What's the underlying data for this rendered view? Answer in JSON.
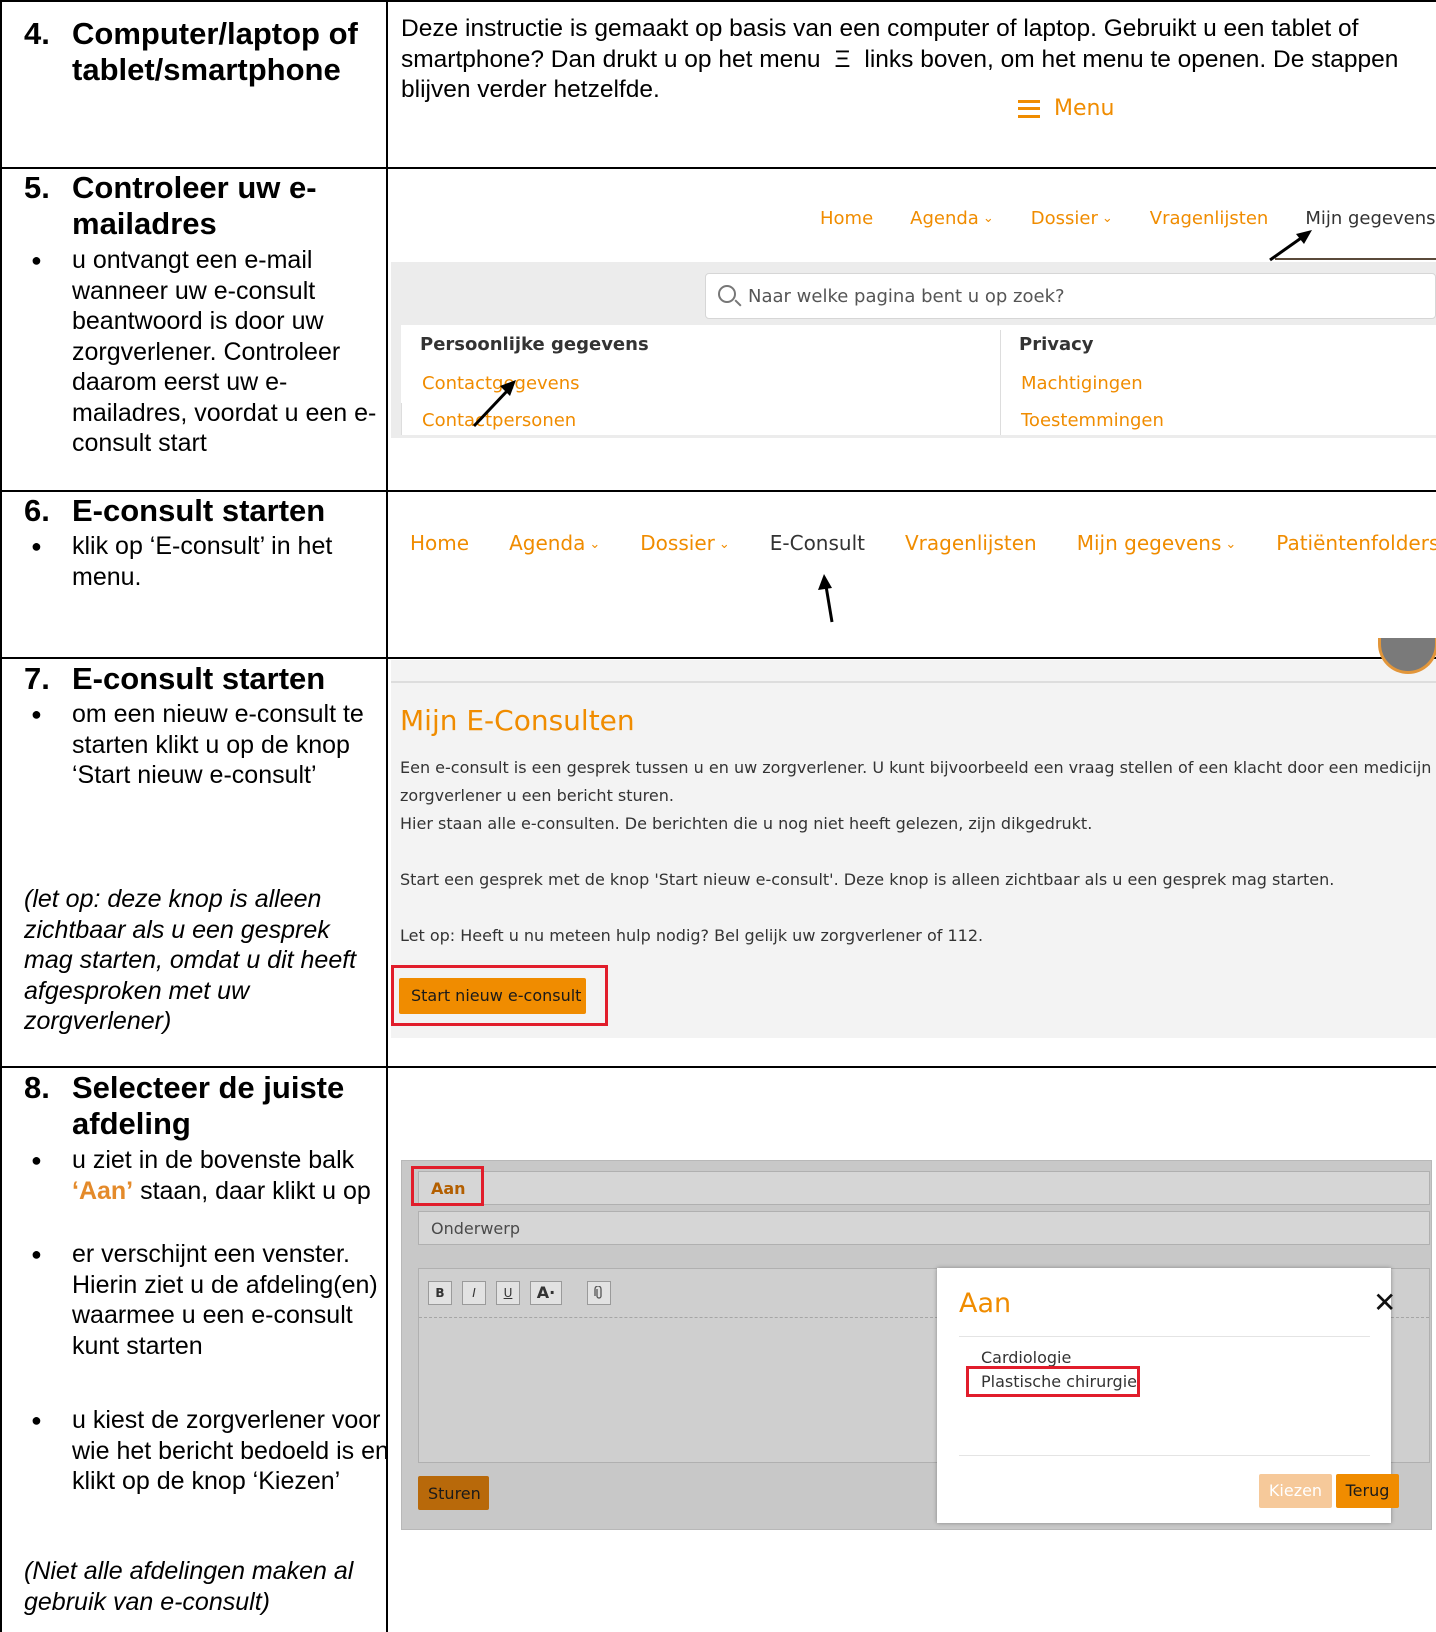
{
  "steps": [
    {
      "num": "4.",
      "title": "Computer/laptop of tablet/smartphone"
    },
    {
      "num": "5.",
      "title": "Controleer uw e-mailadres",
      "bullets": [
        "u ontvangt een e-mail wanneer uw e-consult beantwoord is door uw zorgverlener. Controleer daarom eerst uw e-mailadres, voordat u een e-consult start"
      ]
    },
    {
      "num": "6.",
      "title": "E-consult starten",
      "bullets": [
        "klik op ‘E-consult’ in het menu."
      ]
    },
    {
      "num": "7.",
      "title": "E-consult starten",
      "bullets": [
        "om een nieuw e-consult te starten klikt u op de knop ‘Start nieuw e-consult’"
      ],
      "note": "(let op: deze knop is alleen zichtbaar als u een gesprek mag starten, omdat u dit heeft afgesproken met uw zorgverlener)"
    },
    {
      "num": "8.",
      "title": "Selecteer de juiste afdeling",
      "bullet1_pre": "u ziet in de bovenste balk ",
      "bullet1_em": "‘Aan’",
      "bullet1_post": " staan, daar klikt u op",
      "bullet2": "er verschijnt een venster. Hierin ziet u de afdeling(en) waarmee u een e-consult kunt starten",
      "bullet3": "u kiest de zorgverlener voor wie het bericht bedoeld is en klikt op de knop ‘Kiezen’",
      "note": "(Niet alle afdelingen maken al gebruik van e-consult)"
    }
  ],
  "intro": {
    "text_pre": "Deze instructie is gemaakt op basis van een computer of laptop. Gebruikt u een tablet of smartphone? Dan drukt u op het menu",
    "menu_glyph": "Ξ",
    "text_post": "links boven, om het menu te openen. De stappen blijven verder hetzelfde.",
    "menu_button": "Menu"
  },
  "nav1": {
    "items": [
      "Home",
      "Agenda",
      "Dossier",
      "Vragenlijsten",
      "Mijn gegevens"
    ],
    "search_placeholder": "Naar welke pagina bent u op zoek?",
    "col1_heading": "Persoonlijke gegevens",
    "col1_links": [
      "Contactgegevens",
      "Contactpersonen"
    ],
    "col2_heading": "Privacy",
    "col2_links": [
      "Machtigingen",
      "Toestemmingen"
    ]
  },
  "nav2": {
    "items": [
      "Home",
      "Agenda",
      "Dossier",
      "E-Consult",
      "Vragenlijsten",
      "Mijn gegevens",
      "Patiëntenfolders"
    ]
  },
  "econsult": {
    "title": "Mijn E-Consulten",
    "p1": "Een e-consult is een gesprek tussen u en uw zorgverlener. U kunt bijvoorbeeld een vraag stellen of een klacht door een medicijn (bijv",
    "p1b": "zorgverlener u een bericht sturen.",
    "p2": "Hier staan alle e-consulten. De berichten die u nog niet heeft gelezen, zijn dikgedrukt.",
    "p3": "Start een gesprek met de knop 'Start nieuw e-consult'. Deze knop is alleen zichtbaar als u een gesprek mag starten.",
    "p4": "Let op: Heeft u nu meteen hulp nodig? Bel gelijk uw zorgverlener of 112.",
    "start_button": "Start nieuw e-consult"
  },
  "compose": {
    "aan": "Aan",
    "onderwerp": "Onderwerp",
    "toolbar": [
      "B",
      "I",
      "U",
      "A",
      "·"
    ],
    "send": "Sturen",
    "modal_title": "Aan",
    "modal_close": "✕",
    "options": [
      "Cardiologie",
      "Plastische chirurgie"
    ],
    "choose": "Kiezen",
    "back": "Terug"
  },
  "colors": {
    "accent": "#f08c00",
    "highlight": "#e11d2b",
    "text_orange": "#e48a2a"
  },
  "icons": [
    "arrow-icon",
    "search-icon",
    "chevron-down-icon",
    "hamburger-icon",
    "close-icon",
    "paperclip-icon"
  ]
}
